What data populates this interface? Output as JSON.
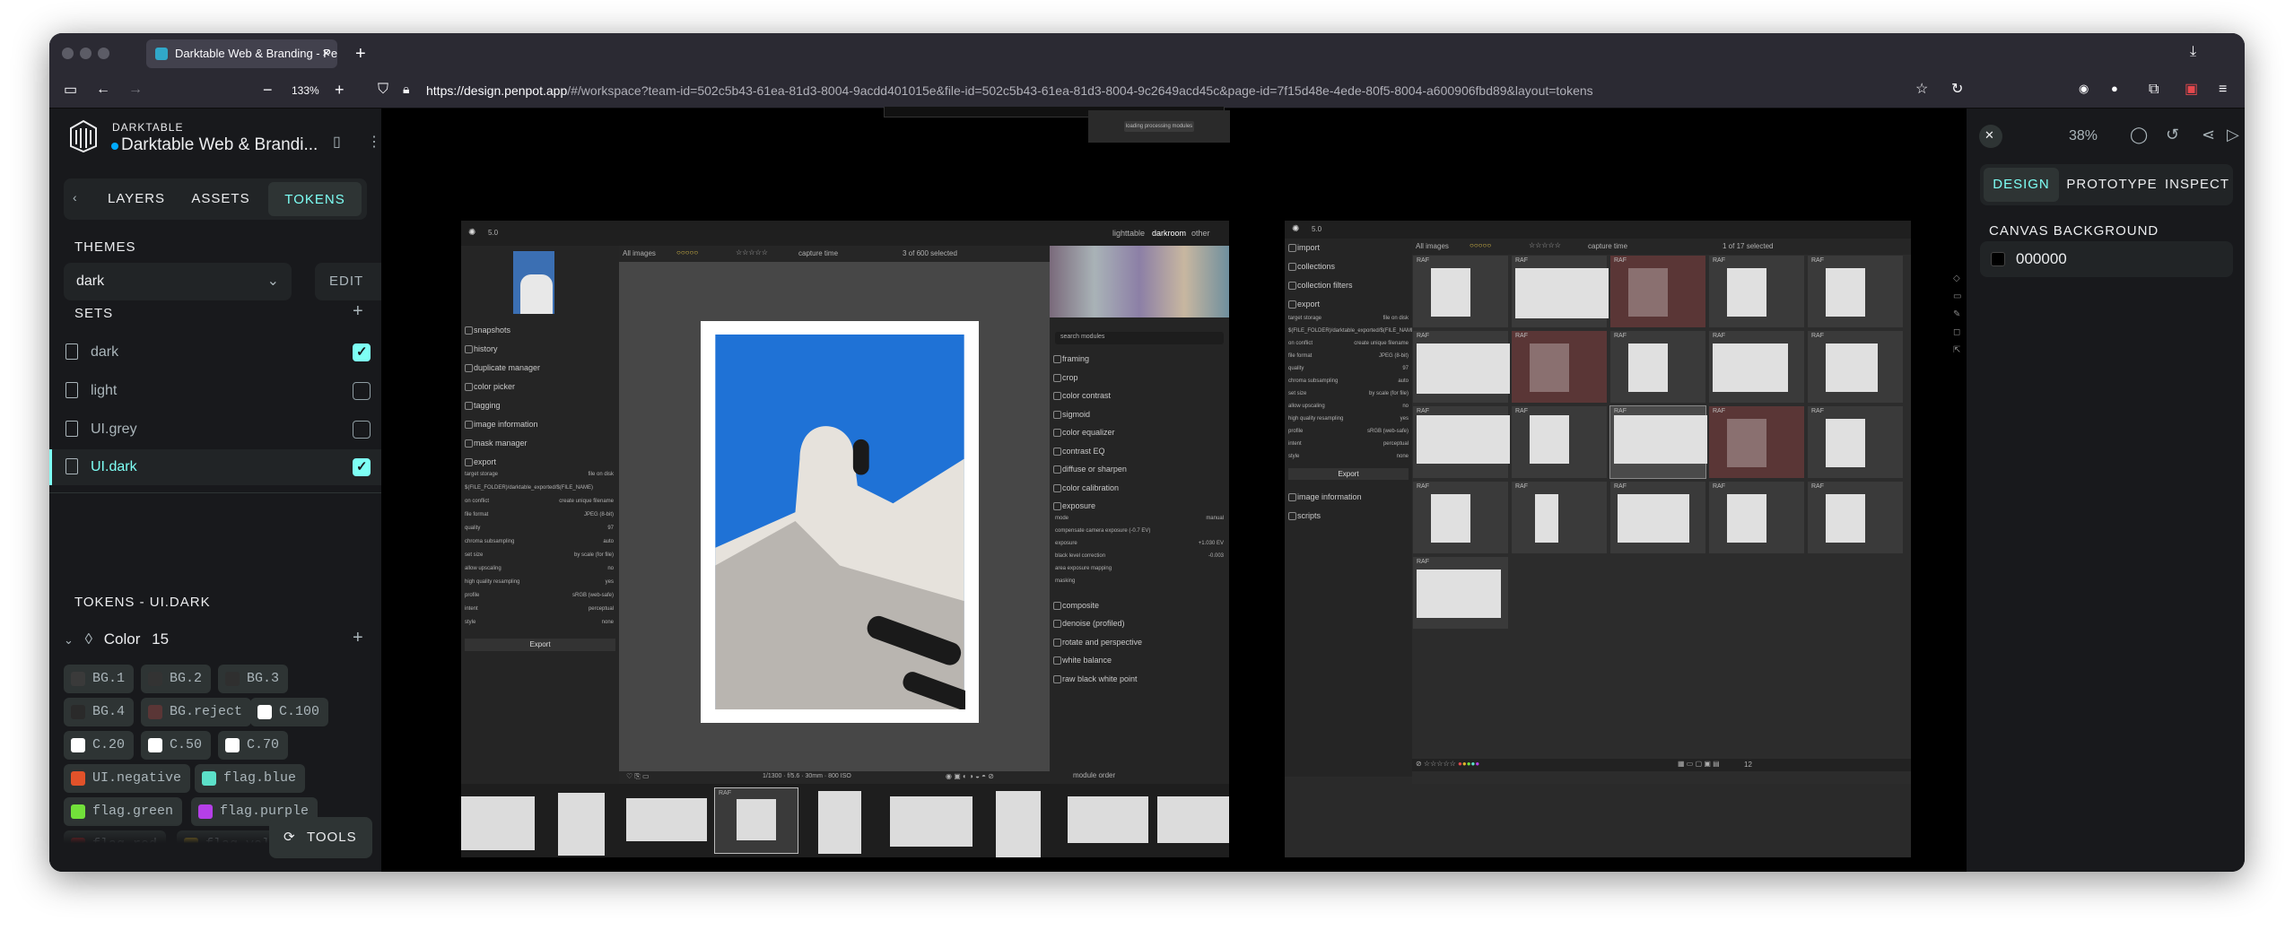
{
  "browser": {
    "tab_title": "Darktable Web & Branding - Pen",
    "zoom": "133%",
    "url_host": "https://design.penpot.app",
    "url_rest": "/#/workspace?team-id=502c5b43-61ea-81d3-8004-9acdd401015e&file-id=502c5b43-61ea-81d3-8004-9c2649acd45c&page-id=7f15d48e-4ede-80f5-8004-a600906fbd89&layout=tokens"
  },
  "left": {
    "project": "DARKTABLE",
    "file_name": "Darktable Web & Brandi...",
    "tabs": [
      "LAYERS",
      "ASSETS",
      "TOKENS"
    ],
    "themes_title": "THEMES",
    "theme_value": "dark",
    "edit_label": "EDIT",
    "sets_title": "SETS",
    "sets": [
      {
        "label": "dark",
        "checked": true
      },
      {
        "label": "light",
        "checked": false
      },
      {
        "label": "UI.grey",
        "checked": false
      },
      {
        "label": "UI.dark",
        "checked": true
      }
    ],
    "tokens_title": "TOKENS - UI.DARK",
    "color_group": "Color",
    "color_count": "15",
    "tokens": [
      {
        "label": "BG.1",
        "color": "#3a3a3a"
      },
      {
        "label": "BG.2",
        "color": "#333333"
      },
      {
        "label": "BG.3",
        "color": "#2f2f2f"
      },
      {
        "label": "BG.4",
        "color": "#2a2a2a"
      },
      {
        "label": "BG.reject",
        "color": "#5a3636"
      },
      {
        "label": "C.100",
        "color": "#ffffff"
      },
      {
        "label": "C.20",
        "color": "#ffffff"
      },
      {
        "label": "C.50",
        "color": "#ffffff"
      },
      {
        "label": "C.70",
        "color": "#ffffff"
      },
      {
        "label": "UI.negative",
        "color": "#e2522a"
      },
      {
        "label": "flag.blue",
        "color": "#5ce0c9"
      },
      {
        "label": "flag.green",
        "color": "#72e03a"
      },
      {
        "label": "flag.purple",
        "color": "#b53fe8"
      },
      {
        "label": "flag.red",
        "color": "#d12c2c"
      },
      {
        "label": "flag.yellow",
        "color": "#e0b52b"
      }
    ],
    "tools_label": "TOOLS"
  },
  "right": {
    "zoom": "38%",
    "tabs": [
      "DESIGN",
      "PROTOTYPE",
      "INSPECT"
    ],
    "canvas_bg_title": "CANVAS BACKGROUND",
    "canvas_bg_value": "000000"
  },
  "canvas": {
    "loading_text": "loading processing modules",
    "darkroom": {
      "version": "5.0",
      "views": [
        "lighttable",
        "darkroom",
        "other"
      ],
      "toolbar_left": "All images",
      "sort": "capture time",
      "selected": "3 of 600 selected",
      "left_modules": [
        "snapshots",
        "history",
        "duplicate manager",
        "color picker",
        "tagging",
        "image information",
        "mask manager",
        "export"
      ],
      "export_rows": [
        [
          "target storage",
          "file on disk"
        ],
        [
          "$(FILE_FOLDER)/darktable_exported/$(FILE_NAME)",
          ""
        ],
        [
          "on conflict",
          "create unique filename"
        ],
        [
          "file format",
          "JPEG (8-bit)"
        ],
        [
          "quality",
          "97"
        ],
        [
          "chroma subsampling",
          "auto"
        ],
        [
          "set size",
          "by scale (for file)"
        ],
        [
          "allow upscaling",
          "no"
        ],
        [
          "high quality resampling",
          "yes"
        ],
        [
          "profile",
          "sRGB (web-safe)"
        ],
        [
          "intent",
          "perceptual"
        ],
        [
          "style",
          "none"
        ]
      ],
      "export_btn": "Export",
      "search_modules": "search modules",
      "right_modules": [
        "framing",
        "crop",
        "color contrast",
        "sigmoid",
        "color equalizer",
        "contrast EQ",
        "diffuse or sharpen",
        "color calibration",
        "exposure"
      ],
      "exposure_rows": [
        [
          "mode",
          "manual"
        ],
        [
          "compensate camera exposure (-0.7 EV)",
          ""
        ],
        [
          "exposure",
          "+1.030 EV"
        ],
        [
          "black level correction",
          "-0.003"
        ],
        [
          "area exposure mapping",
          ""
        ],
        [
          "masking",
          ""
        ]
      ],
      "right_modules_2": [
        "composite",
        "denoise (profiled)",
        "rotate and perspective",
        "white balance",
        "raw black white point"
      ],
      "bottom_info": "1/1300 · f/5.6 · 30mm · 800 ISO",
      "module_order": "module order"
    },
    "lighttable": {
      "version": "5.0",
      "left_modules": [
        "import",
        "collections",
        "collection filters",
        "export"
      ],
      "export_btn": "Export",
      "extra_modules": [
        "image information",
        "scripts"
      ],
      "toolbar_left": "All images",
      "sort": "capture time",
      "selected": "1 of 17 selected",
      "thumb_label": "RAF",
      "grid_count": "12"
    }
  }
}
